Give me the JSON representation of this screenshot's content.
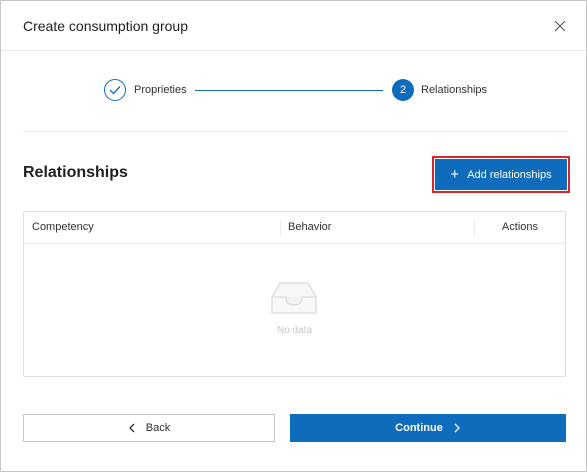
{
  "dialog": {
    "title": "Create consumption group",
    "close_icon": "close-icon"
  },
  "stepper": {
    "steps": [
      {
        "label": "Proprieties",
        "state": "completed",
        "icon": "checkmark-icon"
      },
      {
        "label": "Relationships",
        "state": "active",
        "number": "2"
      }
    ]
  },
  "relationships": {
    "title": "Relationships",
    "add_button_label": "Add relationships",
    "add_button_icon": "plus-icon"
  },
  "table": {
    "columns": [
      "Competency",
      "Behavior",
      "Actions"
    ],
    "rows": [],
    "empty_text": "No data",
    "empty_icon": "empty-inbox-icon"
  },
  "footer": {
    "back_label": "Back",
    "continue_label": "Continue"
  },
  "colors": {
    "accent": "#0f6cbd",
    "highlight": "#d9262e"
  }
}
